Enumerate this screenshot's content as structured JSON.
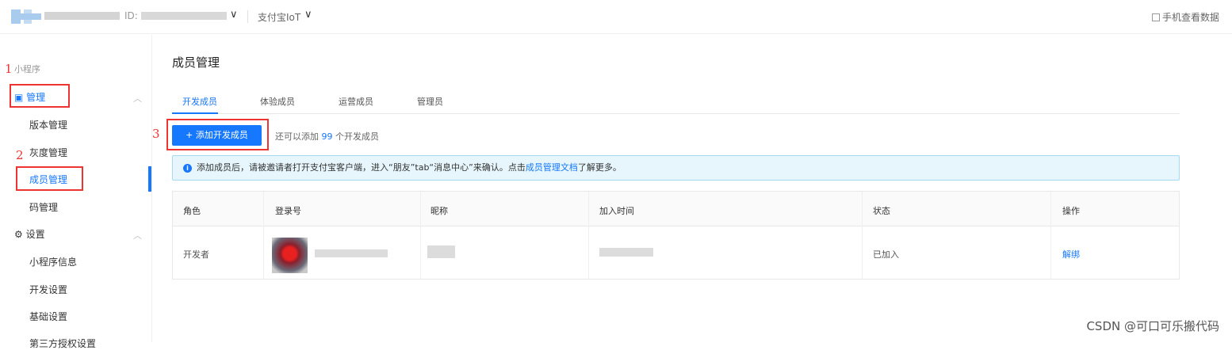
{
  "topbar": {
    "id_label": "ID:",
    "chevron": "∨",
    "platform": "支付宝IoT",
    "mobile_view": "手机查看数据"
  },
  "sidebar": {
    "section_title": "小程序",
    "groups": [
      {
        "label": "管理",
        "icon": "box-icon",
        "items": [
          "版本管理",
          "灰度管理",
          "成员管理",
          "码管理"
        ]
      },
      {
        "label": "设置",
        "icon": "gear-icon",
        "items": [
          "小程序信息",
          "开发设置",
          "基础设置",
          "第三方授权设置"
        ]
      }
    ],
    "active_item": "成员管理"
  },
  "annotations": [
    "1",
    "2",
    "3"
  ],
  "main": {
    "page_title": "成员管理",
    "tabs": [
      "开发成员",
      "体验成员",
      "运营成员",
      "管理员"
    ],
    "active_tab": "开发成员",
    "add_button": "+ 添加开发成员",
    "quota_prefix": "还可以添加",
    "quota_count": "99",
    "quota_suffix": "个开发成员",
    "alert": {
      "text_before": "添加成员后，请被邀请者打开支付宝客户端，进入“朋友”tab“消息中心”来确认。点击",
      "link": "成员管理文档",
      "text_after": "了解更多。"
    },
    "table": {
      "headers": [
        "角色",
        "登录号",
        "昵称",
        "加入时间",
        "状态",
        "操作"
      ],
      "rows": [
        {
          "role": "开发者",
          "status": "已加入",
          "action": "解绑"
        }
      ]
    }
  },
  "watermark": "CSDN @可口可乐搬代码",
  "colors": {
    "accent": "#1677ff",
    "annotation": "#ee3333",
    "alert_bg": "#e6f6fc"
  }
}
